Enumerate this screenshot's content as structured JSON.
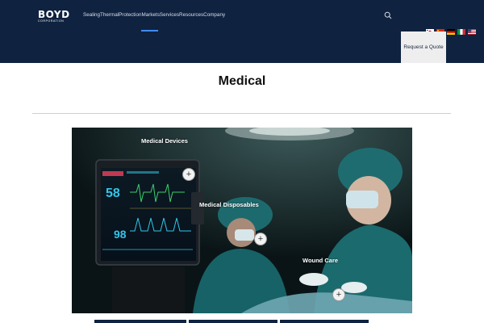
{
  "header": {
    "logo_text": "BOYD",
    "logo_subtext": "CORPORATION",
    "nav": [
      {
        "label": "Sealing"
      },
      {
        "label": "Thermal"
      },
      {
        "label": "Protection"
      },
      {
        "label": "Markets"
      },
      {
        "label": "Services"
      },
      {
        "label": "Resources"
      },
      {
        "label": "Company"
      }
    ],
    "search_icon": "search-icon",
    "quote_label": "Request a Quote",
    "flags": [
      "korea-flag",
      "china-flag",
      "germany-flag",
      "italy-flag",
      "usa-flag"
    ],
    "colors": {
      "background": "#0f2240",
      "accent": "#3f8cff"
    }
  },
  "main": {
    "title": "Medical",
    "hero": {
      "hotspots": [
        {
          "label": "Medical Devices"
        },
        {
          "label": "Medical Disposables"
        },
        {
          "label": "Wound Care"
        }
      ],
      "monitor": {
        "reading_1": "58",
        "reading_2": "98"
      }
    },
    "bottom_tabs": [
      "tab-1",
      "tab-2",
      "tab-3"
    ]
  }
}
